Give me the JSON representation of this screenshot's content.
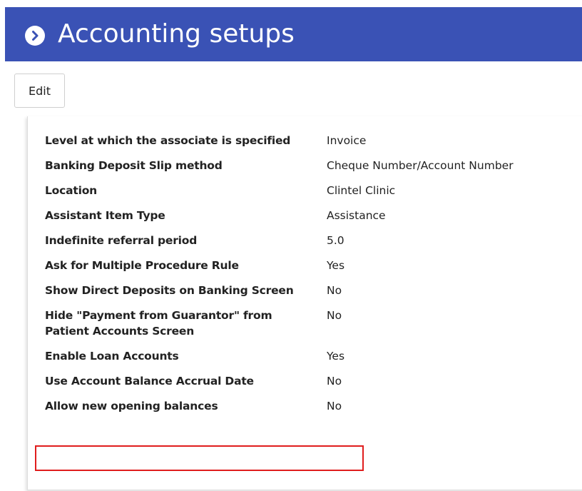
{
  "header": {
    "title": "Accounting setups",
    "icon": "chevron-right-circle-icon",
    "background_color": "#3a52b5"
  },
  "toolbar": {
    "edit_label": "Edit"
  },
  "settings": [
    {
      "label": "Level at which the associate is specified",
      "value": "Invoice"
    },
    {
      "label": "Banking Deposit Slip method",
      "value": "Cheque Number/Account Number"
    },
    {
      "label": "Location",
      "value": "Clintel Clinic"
    },
    {
      "label": "Assistant Item Type",
      "value": "Assistance"
    },
    {
      "label": "Indefinite referral period",
      "value": "5.0"
    },
    {
      "label": "Ask for Multiple Procedure Rule",
      "value": "Yes"
    },
    {
      "label": "Show Direct Deposits on Banking Screen",
      "value": "No"
    },
    {
      "label": "Hide \"Payment from Guarantor\" from Patient Accounts Screen",
      "value": "No"
    },
    {
      "label": "Enable Loan Accounts",
      "value": "Yes"
    },
    {
      "label": "Use Account Balance Accrual Date",
      "value": "No"
    },
    {
      "label": "Allow new opening balances",
      "value": "No"
    }
  ],
  "highlight_color": "#e01d1d"
}
